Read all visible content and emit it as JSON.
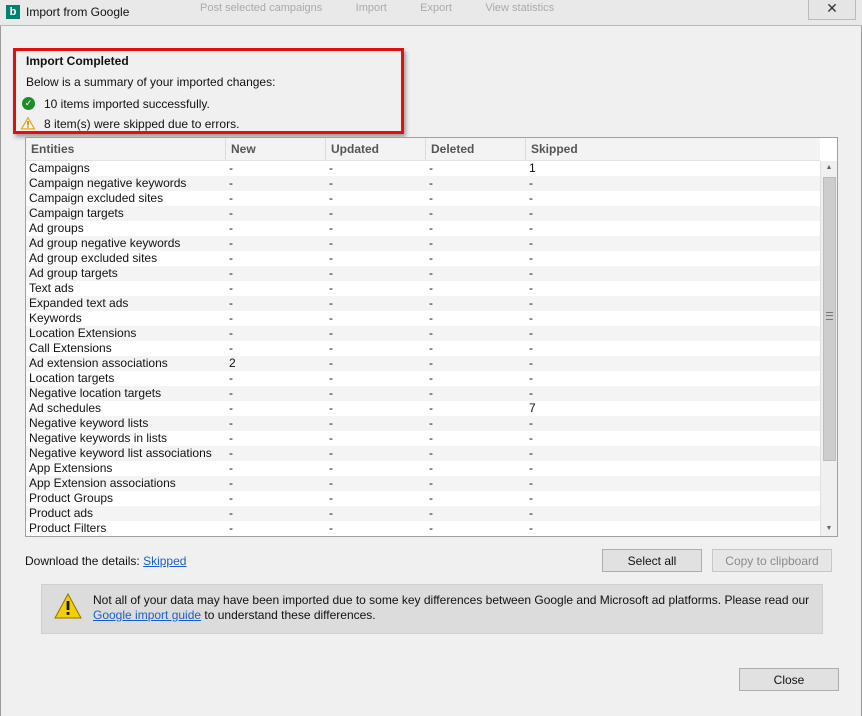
{
  "window": {
    "title": "Import from Google",
    "app_icon_letter": "b",
    "close_glyph": "✕",
    "background_menu": [
      "Post selected campaigns",
      "Import",
      "Export",
      "View statistics"
    ]
  },
  "summary": {
    "heading": "Import Completed",
    "description": "Below is a summary of your imported changes:",
    "success_text": "10 items imported successfully.",
    "skipped_text": "8 item(s) were skipped due to errors."
  },
  "table": {
    "columns": [
      "Entities",
      "New",
      "Updated",
      "Deleted",
      "Skipped"
    ],
    "rows": [
      [
        "Campaigns",
        "-",
        "-",
        "-",
        "1"
      ],
      [
        "Campaign negative keywords",
        "-",
        "-",
        "-",
        "-"
      ],
      [
        "Campaign excluded sites",
        "-",
        "-",
        "-",
        "-"
      ],
      [
        "Campaign targets",
        "-",
        "-",
        "-",
        "-"
      ],
      [
        "Ad groups",
        "-",
        "-",
        "-",
        "-"
      ],
      [
        "Ad group negative keywords",
        "-",
        "-",
        "-",
        "-"
      ],
      [
        "Ad group excluded sites",
        "-",
        "-",
        "-",
        "-"
      ],
      [
        "Ad group targets",
        "-",
        "-",
        "-",
        "-"
      ],
      [
        "Text ads",
        "-",
        "-",
        "-",
        "-"
      ],
      [
        "Expanded text ads",
        "-",
        "-",
        "-",
        "-"
      ],
      [
        "Keywords",
        "-",
        "-",
        "-",
        "-"
      ],
      [
        "Location Extensions",
        "-",
        "-",
        "-",
        "-"
      ],
      [
        "Call Extensions",
        "-",
        "-",
        "-",
        "-"
      ],
      [
        "Ad extension associations",
        "2",
        "-",
        "-",
        "-"
      ],
      [
        "Location targets",
        "-",
        "-",
        "-",
        "-"
      ],
      [
        "Negative location targets",
        "-",
        "-",
        "-",
        "-"
      ],
      [
        "Ad schedules",
        "-",
        "-",
        "-",
        "7"
      ],
      [
        "Negative keyword lists",
        "-",
        "-",
        "-",
        "-"
      ],
      [
        "Negative keywords in lists",
        "-",
        "-",
        "-",
        "-"
      ],
      [
        "Negative keyword list associations",
        "-",
        "-",
        "-",
        "-"
      ],
      [
        "App Extensions",
        "-",
        "-",
        "-",
        "-"
      ],
      [
        "App Extension associations",
        "-",
        "-",
        "-",
        "-"
      ],
      [
        "Product Groups",
        "-",
        "-",
        "-",
        "-"
      ],
      [
        "Product ads",
        "-",
        "-",
        "-",
        "-"
      ],
      [
        "Product Filters",
        "-",
        "-",
        "-",
        "-"
      ]
    ]
  },
  "download": {
    "label": "Download the details: ",
    "link": "Skipped"
  },
  "buttons": {
    "select_all": "Select all",
    "copy": "Copy to clipboard",
    "close": "Close"
  },
  "notice": {
    "text_before": "Not all of your data may have been imported due to some key differences between Google and Microsoft ad platforms. Please read our ",
    "link": "Google import guide",
    "text_after": " to understand these differences."
  },
  "colors": {
    "highlight_border": "#e01010",
    "success": "#1e8c2a",
    "warning": "#f0a020",
    "link": "#1a5fd0"
  }
}
